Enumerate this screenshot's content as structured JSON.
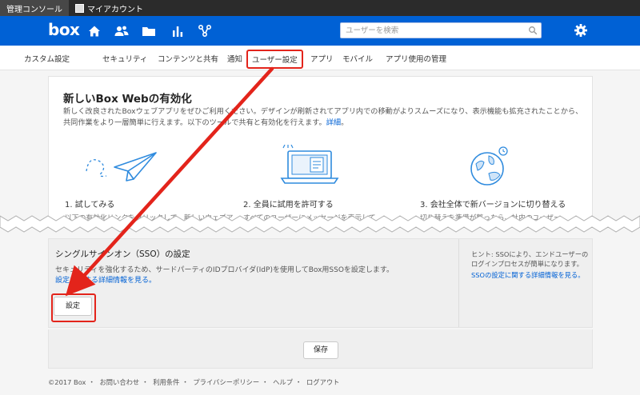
{
  "top_tabs": [
    {
      "label": "管理コンソール"
    },
    {
      "label": "マイアカウント"
    }
  ],
  "header": {
    "logo": "box",
    "nav_icons": [
      "home-icon",
      "users-icon",
      "folder-icon",
      "reports-icon",
      "workflow-icon"
    ],
    "search_placeholder": "ユーザーを検索",
    "settings_icon": "gear-icon"
  },
  "subnav": {
    "items": [
      {
        "label": "カスタム設定"
      },
      {
        "label": "セキュリティ"
      },
      {
        "label": "コンテンツと共有"
      },
      {
        "label": "通知"
      },
      {
        "label": "ユーザー設定"
      },
      {
        "label": "アプリ"
      },
      {
        "label": "モバイル"
      },
      {
        "label": "アプリ使用の管理"
      }
    ],
    "highlighted": "ユーザー設定"
  },
  "new_box_card": {
    "title": "新しいBox Webの有効化",
    "description": "新しく改良されたBoxウェブアプリをぜひご利用ください。デザインが刷新されてアプリ内での移動がよりスムーズになり、表示機能も拡充されたことから、共同作業をより一層簡単に行えます。以下のツールで共有と有効化を行えます。",
    "details_link": "詳細",
    "features": [
      {
        "title": "1. 試してみる",
        "text": "以下の有効化リンクをクリックして、新しいウェブア"
      },
      {
        "title": "2. 全員に試用を許可する",
        "text": "すべてのユーザーにメッセージを表示して"
      },
      {
        "title": "3. 会社全体で新バージョンに切り替える",
        "text": "切り替えを準備が整ったら、社内のユーザー"
      }
    ]
  },
  "sso_card": {
    "title": "シングルサインオン（SSO）の設定",
    "description": "セキュリティを強化するため、サードパーティのIDプロバイダ(IdP)を使用してBox用SSOを設定します。",
    "details_link": "設定に関する詳細情報を見る。",
    "setup_button": "設定",
    "hint_text": "ヒント: SSOにより、エンドユーザーのログインプロセスが簡単になります。",
    "hint_link": "SSOの設定に関する詳細情報を見る。"
  },
  "save_button": "保存",
  "footer": {
    "copyright": "©2017 Box",
    "links": [
      "お問い合わせ",
      "利用条件",
      "プライバシーポリシー",
      "ヘルプ",
      "ログアウト"
    ]
  },
  "accent_colors": {
    "box_blue": "#0061d5",
    "annotation_red": "#e3241b"
  }
}
